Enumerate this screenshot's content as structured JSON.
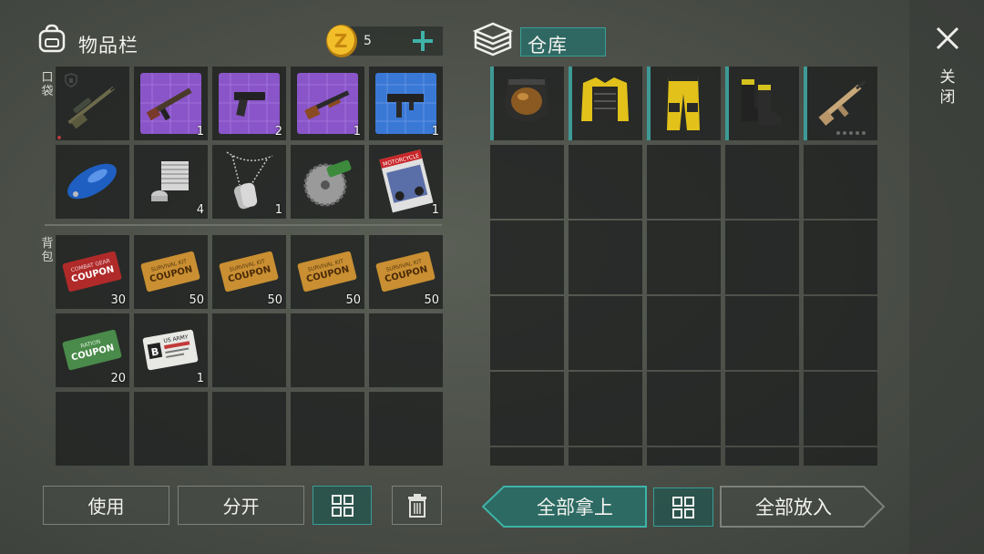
{
  "inventory": {
    "title": "物品栏",
    "icon": "backpack-icon",
    "currency": {
      "icon": "coin-icon",
      "amount": "5",
      "add_icon": "plus-icon"
    },
    "pocket_label": "口袋",
    "bag_label": "背包",
    "pocket_slots": [
      {
        "item": "sniper-rifle-icon",
        "count": ""
      },
      {
        "item": "ak-blueprint-icon",
        "count": "1"
      },
      {
        "item": "pistol-blueprint-icon",
        "count": "2"
      },
      {
        "item": "shotgun-blueprint-icon",
        "count": "1"
      },
      {
        "item": "smg-blueprint-icon",
        "count": "1"
      },
      {
        "item": "fuel-tank-icon",
        "count": ""
      },
      {
        "item": "engine-cylinder-icon",
        "count": "4"
      },
      {
        "item": "dog-tags-icon",
        "count": "1"
      },
      {
        "item": "saw-blade-icon",
        "count": ""
      },
      {
        "item": "motorcycle-magazine-icon",
        "count": "1"
      }
    ],
    "bag_slots": [
      {
        "item": "combat-gear-coupon-icon",
        "count": "30",
        "text_top": "COMBAT GEAR",
        "text_main": "COUPON"
      },
      {
        "item": "survival-kit-coupon-icon",
        "count": "50",
        "text_top": "SURVIVAL KIT",
        "text_main": "COUPON"
      },
      {
        "item": "survival-kit-coupon-icon",
        "count": "50",
        "text_top": "SURVIVAL KIT",
        "text_main": "COUPON"
      },
      {
        "item": "survival-kit-coupon-icon",
        "count": "50",
        "text_top": "SURVIVAL KIT",
        "text_main": "COUPON"
      },
      {
        "item": "survival-kit-coupon-icon",
        "count": "50",
        "text_top": "SURVIVAL KIT",
        "text_main": "COUPON"
      },
      {
        "item": "ration-coupon-icon",
        "count": "20",
        "text_top": "RATION",
        "text_main": "COUPON"
      },
      {
        "item": "us-army-card-icon",
        "count": "1",
        "text_top": "US ARMY",
        "text_main": "B"
      },
      {
        "item": "",
        "count": ""
      },
      {
        "item": "",
        "count": ""
      },
      {
        "item": "",
        "count": ""
      },
      {
        "item": "",
        "count": ""
      },
      {
        "item": "",
        "count": ""
      },
      {
        "item": "",
        "count": ""
      },
      {
        "item": "",
        "count": ""
      },
      {
        "item": "",
        "count": ""
      }
    ],
    "buttons": {
      "use": "使用",
      "split": "分开",
      "sort_icon": "grid-sort-icon",
      "delete_icon": "trash-icon"
    }
  },
  "storage": {
    "title": "仓库",
    "icon": "stack-icon",
    "equipped": [
      {
        "item": "gas-mask-helmet-icon"
      },
      {
        "item": "yellow-armor-vest-icon"
      },
      {
        "item": "yellow-armor-pants-icon"
      },
      {
        "item": "combat-boots-icon"
      },
      {
        "item": "assault-rifle-icon"
      }
    ],
    "buttons": {
      "take_all": "全部拿上",
      "sort_icon": "grid-sort-icon",
      "put_all": "全部放入"
    }
  },
  "close": {
    "label": "关闭",
    "icon": "close-icon"
  },
  "colors": {
    "accent": "#3a9d96",
    "coin": "#e2a81c",
    "purple_blueprint": "#8a55c8",
    "blue_blueprint": "#3a78d6",
    "red_coupon": "#b02a2a",
    "gold_coupon": "#c98f32",
    "green_coupon": "#4a8a4a"
  }
}
